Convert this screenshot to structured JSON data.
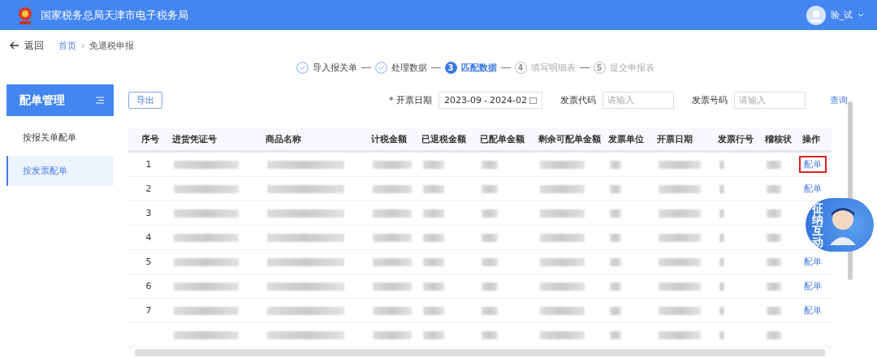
{
  "header": {
    "title": "国家税务总局天津市电子税务局",
    "user": "验_试"
  },
  "breadcrumb": {
    "back": "返回",
    "separator": "›",
    "items": [
      "首页",
      "免退税申报"
    ]
  },
  "steps": [
    {
      "label": "导入报关单",
      "done": true,
      "active": false
    },
    {
      "label": "处理数据",
      "done": true,
      "active": false
    },
    {
      "number": "3",
      "label": "匹配数据",
      "done": false,
      "active": true
    },
    {
      "number": "4",
      "label": "填写明细表",
      "done": false,
      "active": false
    },
    {
      "number": "5",
      "label": "提交申报表",
      "done": false,
      "active": false
    }
  ],
  "sidebar": {
    "title": "配单管理",
    "items": [
      {
        "label": "按报关单配单",
        "selected": false
      },
      {
        "label": "按发票配单",
        "selected": true
      }
    ]
  },
  "toolbar": {
    "export": "导出",
    "filters": [
      {
        "kind": "daterange",
        "mark": "*",
        "label": "开票日期",
        "from": "2023-09",
        "separator": "-",
        "to": "2024-02"
      },
      {
        "kind": "text",
        "label": "发票代码",
        "placeholder": "请输入"
      },
      {
        "kind": "text",
        "label": "发票号码",
        "placeholder": "请输入"
      }
    ],
    "query": "查询"
  },
  "table": {
    "columns": [
      "序号",
      "进货凭证号",
      "商品名称",
      "计税金额",
      "已退税金额",
      "已配单金额",
      "剩余可配单金额",
      "发票单位",
      "开票日期",
      "发票行号",
      "稽核状",
      "操作"
    ],
    "rows": [
      {
        "index": "1",
        "action": "配单",
        "highlighted": true
      },
      {
        "index": "2",
        "action": "配单",
        "highlighted": false
      },
      {
        "index": "3"
      },
      {
        "index": "4"
      },
      {
        "index": "5",
        "action": "配单",
        "highlighted": false
      },
      {
        "index": "6",
        "action": "配单",
        "highlighted": false
      },
      {
        "index": "7",
        "action": "配单",
        "highlighted": false
      }
    ]
  },
  "assistant": {
    "label": "征纳互动"
  }
}
